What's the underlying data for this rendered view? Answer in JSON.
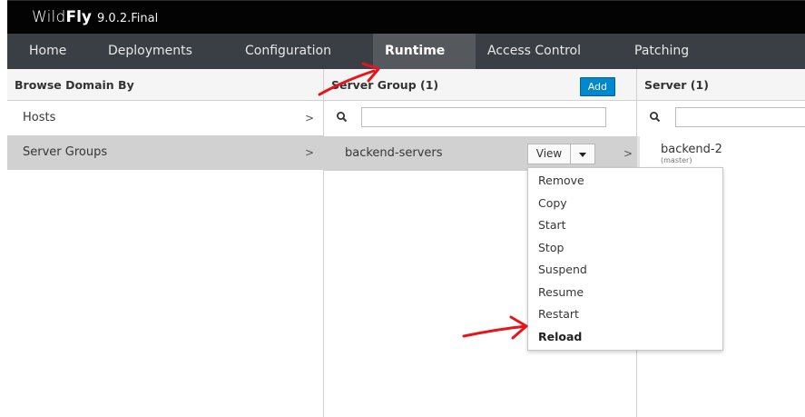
{
  "app": {
    "brand_light": "Wild",
    "brand_bold": "Fly",
    "version": "9.0.2.Final"
  },
  "nav": {
    "items": [
      {
        "label": "Home"
      },
      {
        "label": "Deployments"
      },
      {
        "label": "Configuration"
      },
      {
        "label": "Runtime",
        "active": true
      },
      {
        "label": "Access Control"
      },
      {
        "label": "Patching"
      }
    ]
  },
  "browse": {
    "header": "Browse Domain By",
    "items": [
      {
        "label": "Hosts",
        "chevron": ">"
      },
      {
        "label": "Server Groups",
        "chevron": ">",
        "selected": true
      }
    ]
  },
  "server_group": {
    "header": "Server Group (1)",
    "add_label": "Add",
    "search_placeholder": "",
    "rows": [
      {
        "label": "backend-servers",
        "view_label": "View",
        "chevron": ">"
      }
    ]
  },
  "server": {
    "header": "Server (1)",
    "search_placeholder": "",
    "items": [
      {
        "name": "backend-2",
        "sub": "(master)"
      }
    ]
  },
  "dropdown": {
    "items": [
      {
        "label": "Remove"
      },
      {
        "label": "Copy"
      },
      {
        "label": "Start"
      },
      {
        "label": "Stop"
      },
      {
        "label": "Suspend"
      },
      {
        "label": "Resume"
      },
      {
        "label": "Restart"
      },
      {
        "label": "Reload",
        "bold": true
      }
    ]
  },
  "colors": {
    "topbar": "#030303",
    "navbar": "#393f44",
    "nav_active": "#55595d",
    "accent_button": "#0088ce",
    "selected_row": "#d1d1d1",
    "annotation_arrow": "#e8141c"
  }
}
